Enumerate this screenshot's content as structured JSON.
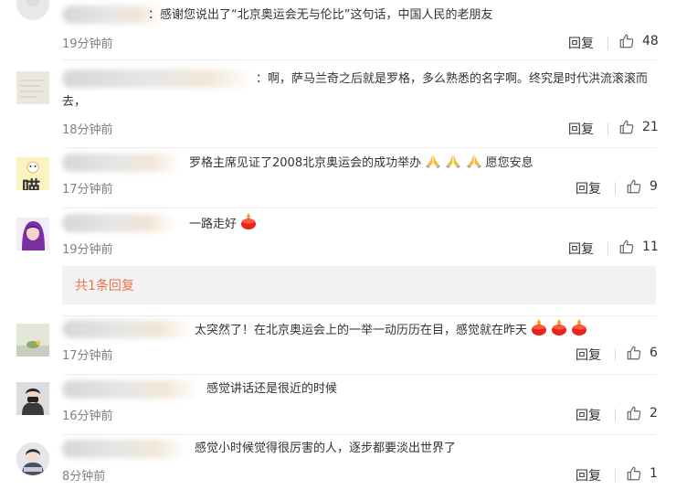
{
  "comments": [
    {
      "text": "：感谢您说出了“北京奥运会无与伦比”这句话，中国人民的老朋友",
      "time": "19分钟前",
      "reply_label": "回复",
      "likes": "48"
    },
    {
      "text": "：啊，萨马兰奇之后就是罗格，多么熟悉的名字啊。终究是时代洪流滚滚而去，",
      "time": "18分钟前",
      "reply_label": "回复",
      "likes": "21"
    },
    {
      "text": "罗格主席见证了2008北京奥运会的成功举办",
      "text_after": "愿您安息",
      "avatar_text": "喵",
      "time": "17分钟前",
      "reply_label": "回复",
      "likes": "9"
    },
    {
      "text": "一路走好",
      "time": "19分钟前",
      "reply_label": "回复",
      "likes": "11",
      "sub_replies_label": "共1条回复"
    },
    {
      "text": "太突然了！在北京奥运会上的一举一动历历在目，感觉就在昨天",
      "time": "17分钟前",
      "reply_label": "回复",
      "likes": "6"
    },
    {
      "text": "感觉讲话还是很近的时候",
      "time": "16分钟前",
      "reply_label": "回复",
      "likes": "2"
    },
    {
      "text": "感觉小时候觉得很厉害的人，逐步都要淡出世界了",
      "time": "8分钟前",
      "reply_label": "回复",
      "likes": "1"
    }
  ],
  "colors": {
    "link_orange": "#eb7350",
    "time_gray": "#808080",
    "text": "#333333",
    "sub_reply_bg": "#f2f2f2"
  },
  "icons": {
    "like": "thumbs-up-icon",
    "pray": "praying-hands-emoji",
    "candle": "candle-emoji"
  }
}
